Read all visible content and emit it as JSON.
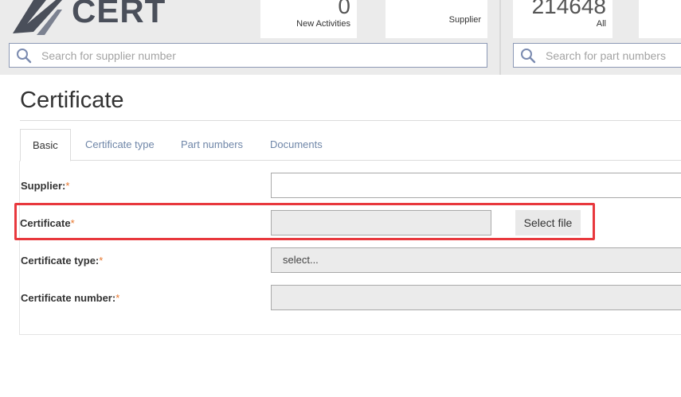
{
  "app": {
    "logo_text": "CERT"
  },
  "header": {
    "stats": [
      {
        "value": "0",
        "label": "New Activities"
      },
      {
        "value": "",
        "label": "Supplier"
      },
      {
        "value": "214648",
        "label": "All"
      }
    ],
    "search_supplier": {
      "placeholder": "Search for supplier number",
      "value": ""
    },
    "search_parts": {
      "placeholder": "Search for part numbers",
      "value": ""
    }
  },
  "page": {
    "title": "Certificate"
  },
  "tabs": [
    {
      "label": "Basic",
      "active": true
    },
    {
      "label": "Certificate type",
      "active": false
    },
    {
      "label": "Part numbers",
      "active": false
    },
    {
      "label": "Documents",
      "active": false
    }
  ],
  "form": {
    "required_mark": "*",
    "supplier": {
      "label": "Supplier:",
      "value": ""
    },
    "certificate": {
      "label": "Certificate",
      "value": "",
      "button_label": "Select file"
    },
    "certificate_type": {
      "label": "Certificate type:",
      "selected": "select..."
    },
    "certificate_number": {
      "label": "Certificate number:",
      "value": ""
    }
  },
  "colors": {
    "accent_link": "#6f86a8",
    "required": "#e8762c",
    "highlight": "#e8383d"
  },
  "icons": [
    "search-icon",
    "cert-logo-icon"
  ]
}
